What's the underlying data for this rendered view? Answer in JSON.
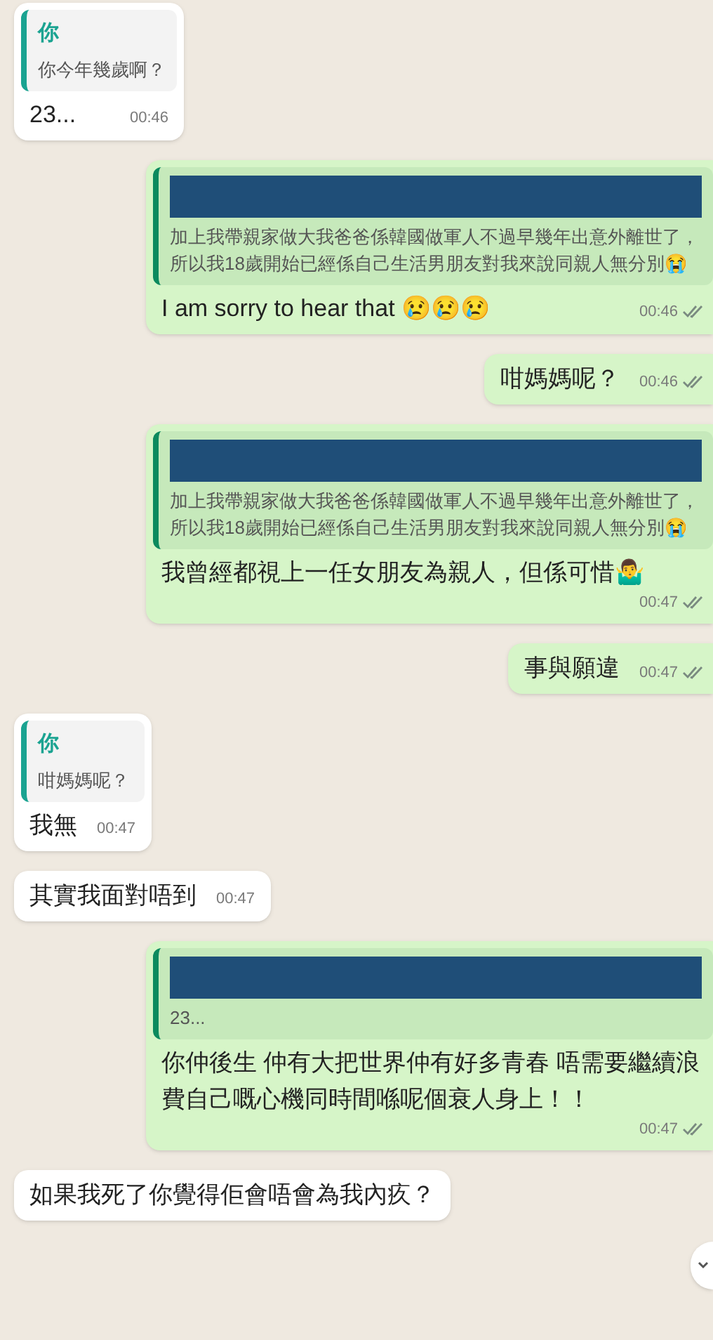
{
  "messages": [
    {
      "kind": "in",
      "quote": {
        "author": "你",
        "text": "你今年幾歲啊？"
      },
      "text": "23...",
      "time": "00:46"
    },
    {
      "kind": "out",
      "quote": {
        "redacted": true,
        "text": "加上我帶親家做大我爸爸係韓國做軍人不過早幾年出意外離世了，所以我18歲開始已經係自己生活男朋友對我來說同親人無分別😭"
      },
      "text": "I am sorry to hear that 😢😢😢",
      "time": "00:46",
      "read": true
    },
    {
      "kind": "out",
      "text": "咁媽媽呢？",
      "time": "00:46",
      "read": true
    },
    {
      "kind": "out",
      "quote": {
        "redacted": true,
        "text": "加上我帶親家做大我爸爸係韓國做軍人不過早幾年出意外離世了，所以我18歲開始已經係自己生活男朋友對我來說同親人無分別😭"
      },
      "text": "我曾經都視上一任女朋友為親人，但係可惜🤷‍♂️",
      "time": "00:47",
      "read": true
    },
    {
      "kind": "out",
      "text": "事與願違",
      "time": "00:47",
      "read": true
    },
    {
      "kind": "in",
      "quote": {
        "author": "你",
        "text": "咁媽媽呢？"
      },
      "text": "我無",
      "time": "00:47"
    },
    {
      "kind": "in",
      "text": "其實我面對唔到",
      "time": "00:47"
    },
    {
      "kind": "out",
      "quote": {
        "redacted": true,
        "text": "23..."
      },
      "text": "你仲後生 仲有大把世界仲有好多青春 唔需要繼續浪費自己嘅心機同時間喺呢個衰人身上！！",
      "time": "00:47",
      "read": true
    },
    {
      "kind": "in",
      "text": "如果我死了你覺得佢會唔會為我內疚？"
    }
  ]
}
